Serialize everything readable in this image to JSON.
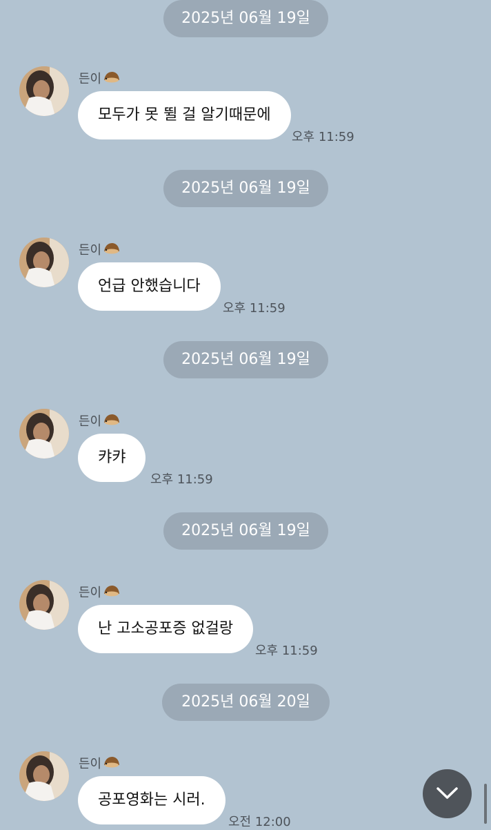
{
  "chat": {
    "sender_name": "든이",
    "groups": [
      {
        "date": "2025년 06월 19일",
        "message": "모두가 못 뛸 걸 알기때문에",
        "time": "오후 11:59"
      },
      {
        "date": "2025년 06월 19일",
        "message": "언급 안했습니다",
        "time": "오후 11:59"
      },
      {
        "date": "2025년 06월 19일",
        "message": "캬캬",
        "time": "오후 11:59"
      },
      {
        "date": "2025년 06월 19일",
        "message": "난 고소공포증 없걸랑",
        "time": "오후 11:59"
      },
      {
        "date": "2025년 06월 20일",
        "message": "공포영화는 시러.",
        "time": "오전 12:00"
      }
    ]
  },
  "icons": {
    "sender_badge": "hedgehog-icon",
    "scroll_button": "chevron-down-icon"
  },
  "colors": {
    "background": "#b2c3d1",
    "date_pill": "#9ba9b6",
    "bubble": "#ffffff",
    "scroll_button": "#4f545a"
  }
}
